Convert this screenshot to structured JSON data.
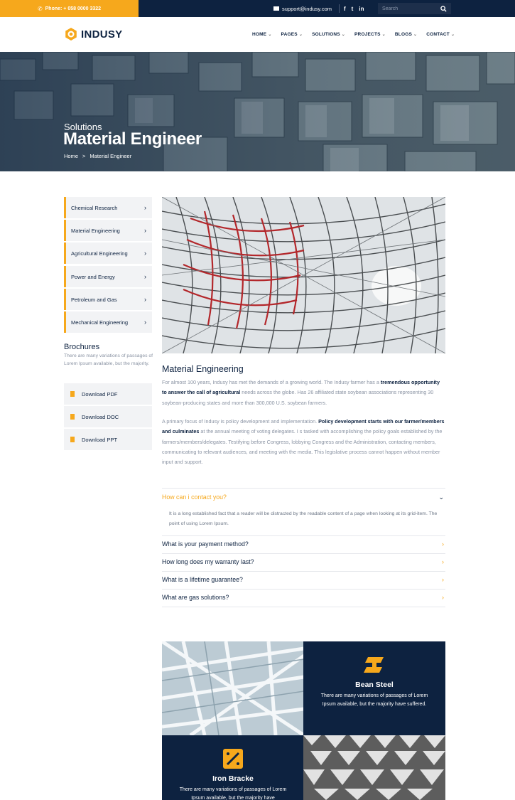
{
  "topbar": {
    "phone": "Phone: + 058 0000 3322",
    "email": "support@indusy.com",
    "social": [
      "f",
      "t",
      "in"
    ],
    "search_placeholder": "Search"
  },
  "header": {
    "logo_text": "INDUSY",
    "nav": [
      "HOME",
      "PAGES",
      "SOLUTIONS",
      "PROJECTS",
      "BLOGS",
      "CONTACT"
    ]
  },
  "hero": {
    "subtitle": "Solutions",
    "title": "Material Engineer",
    "breadcrumb": [
      "Home",
      ">",
      "Material Engineer"
    ]
  },
  "sidebar": {
    "items": [
      {
        "label": "Chemical Research"
      },
      {
        "label": "Material Engineering"
      },
      {
        "label": "Agricultural Engineering"
      },
      {
        "label": "Power and Energy"
      },
      {
        "label": "Petroleum and Gas"
      },
      {
        "label": "Mechanical Engineering"
      }
    ],
    "brochures_title": "Brochures",
    "brochures_text": "There are many variations of passages of Lorem Ipsum available, but the majority.",
    "downloads": [
      {
        "label": "Download PDF"
      },
      {
        "label": "Download DOC"
      },
      {
        "label": "Download PPT"
      }
    ]
  },
  "main": {
    "title": "Material Engineering",
    "p1_a": "For almost 100 years, Indusy has met the demands of a growing world. The Indusy farmer has a ",
    "p1_b": "tremendous opportunity to answer the call of agricultural",
    "p1_c": " needs across the globe. Has 26 affiliated state soybean associations representing 30 soybean-producing states and more than 300,000 U.S. soybean farmers.",
    "p2_a": "A primary focus of Indusy is policy development and implementation. ",
    "p2_b": "Policy development starts with our farmer/members and culminates",
    "p2_c": " at the annual meeting of voting delegates. I s tasked with accomplishing the policy goals established by the farmers/members/delegates. Testifying before Congress, lobbying Congress and the Administration, contacting members, communicating to relevant audiences, and meeting with the media. This legislative process cannot happen without member input and support."
  },
  "faq": {
    "open_question": "How can i contact you?",
    "open_answer": "It is a long established fact that a reader will be distracted by the readable content of a page when looking at its grid-item. The point of using Lorem Ipsum.",
    "questions": [
      "What is your payment method?",
      "How long does my warranty last?",
      "What is a lifetime guarantee?",
      "What are gas solutions?"
    ]
  },
  "features": [
    {
      "title": "Bean Steel",
      "text": "There are many variations of passages of Lorem Ipsum available, but the majority have suffered."
    },
    {
      "title": "Iron Bracke",
      "text": "There are many variations of passages of Lorem Ipsum available, but the majority have"
    }
  ],
  "colors": {
    "accent": "#f6a81c",
    "navy": "#0d2240",
    "light_gray": "#f2f3f5",
    "body_text": "#8a93a3"
  }
}
